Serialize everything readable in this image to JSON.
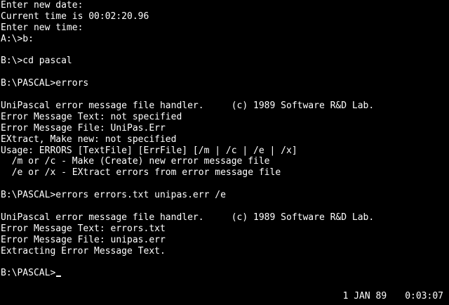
{
  "terminal": {
    "lines": [
      "Enter new date:",
      "Current time is 00:02:20.96",
      "Enter new time:",
      "A:\\>b:",
      "",
      "B:\\>cd pascal",
      "",
      "B:\\PASCAL>errors",
      "",
      "UniPascal error message file handler.     (c) 1989 Software R&D Lab.",
      "Error Message Text: not specified",
      "Error Message File: UniPas.Err",
      "EXtract, Make new: not specified",
      "Usage: ERRORS [TextFile] [ErrFile] [/m | /c | /e | /x]",
      "  /m or /c - Make (Create) new error message file",
      "  /e or /x - EXtract errors from error message file",
      "",
      "B:\\PASCAL>errors errors.txt unipas.err /e",
      "",
      "UniPascal error message file handler.     (c) 1989 Software R&D Lab.",
      "Error Message Text: errors.txt",
      "Error Message File: unipas.err",
      "Extracting Error Message Text.",
      "",
      "B:\\PASCAL>"
    ]
  },
  "status": {
    "date": "1 JAN 89",
    "time": "0:03:07"
  },
  "colors": {
    "background": "#000000",
    "foreground": "#ffffff"
  }
}
